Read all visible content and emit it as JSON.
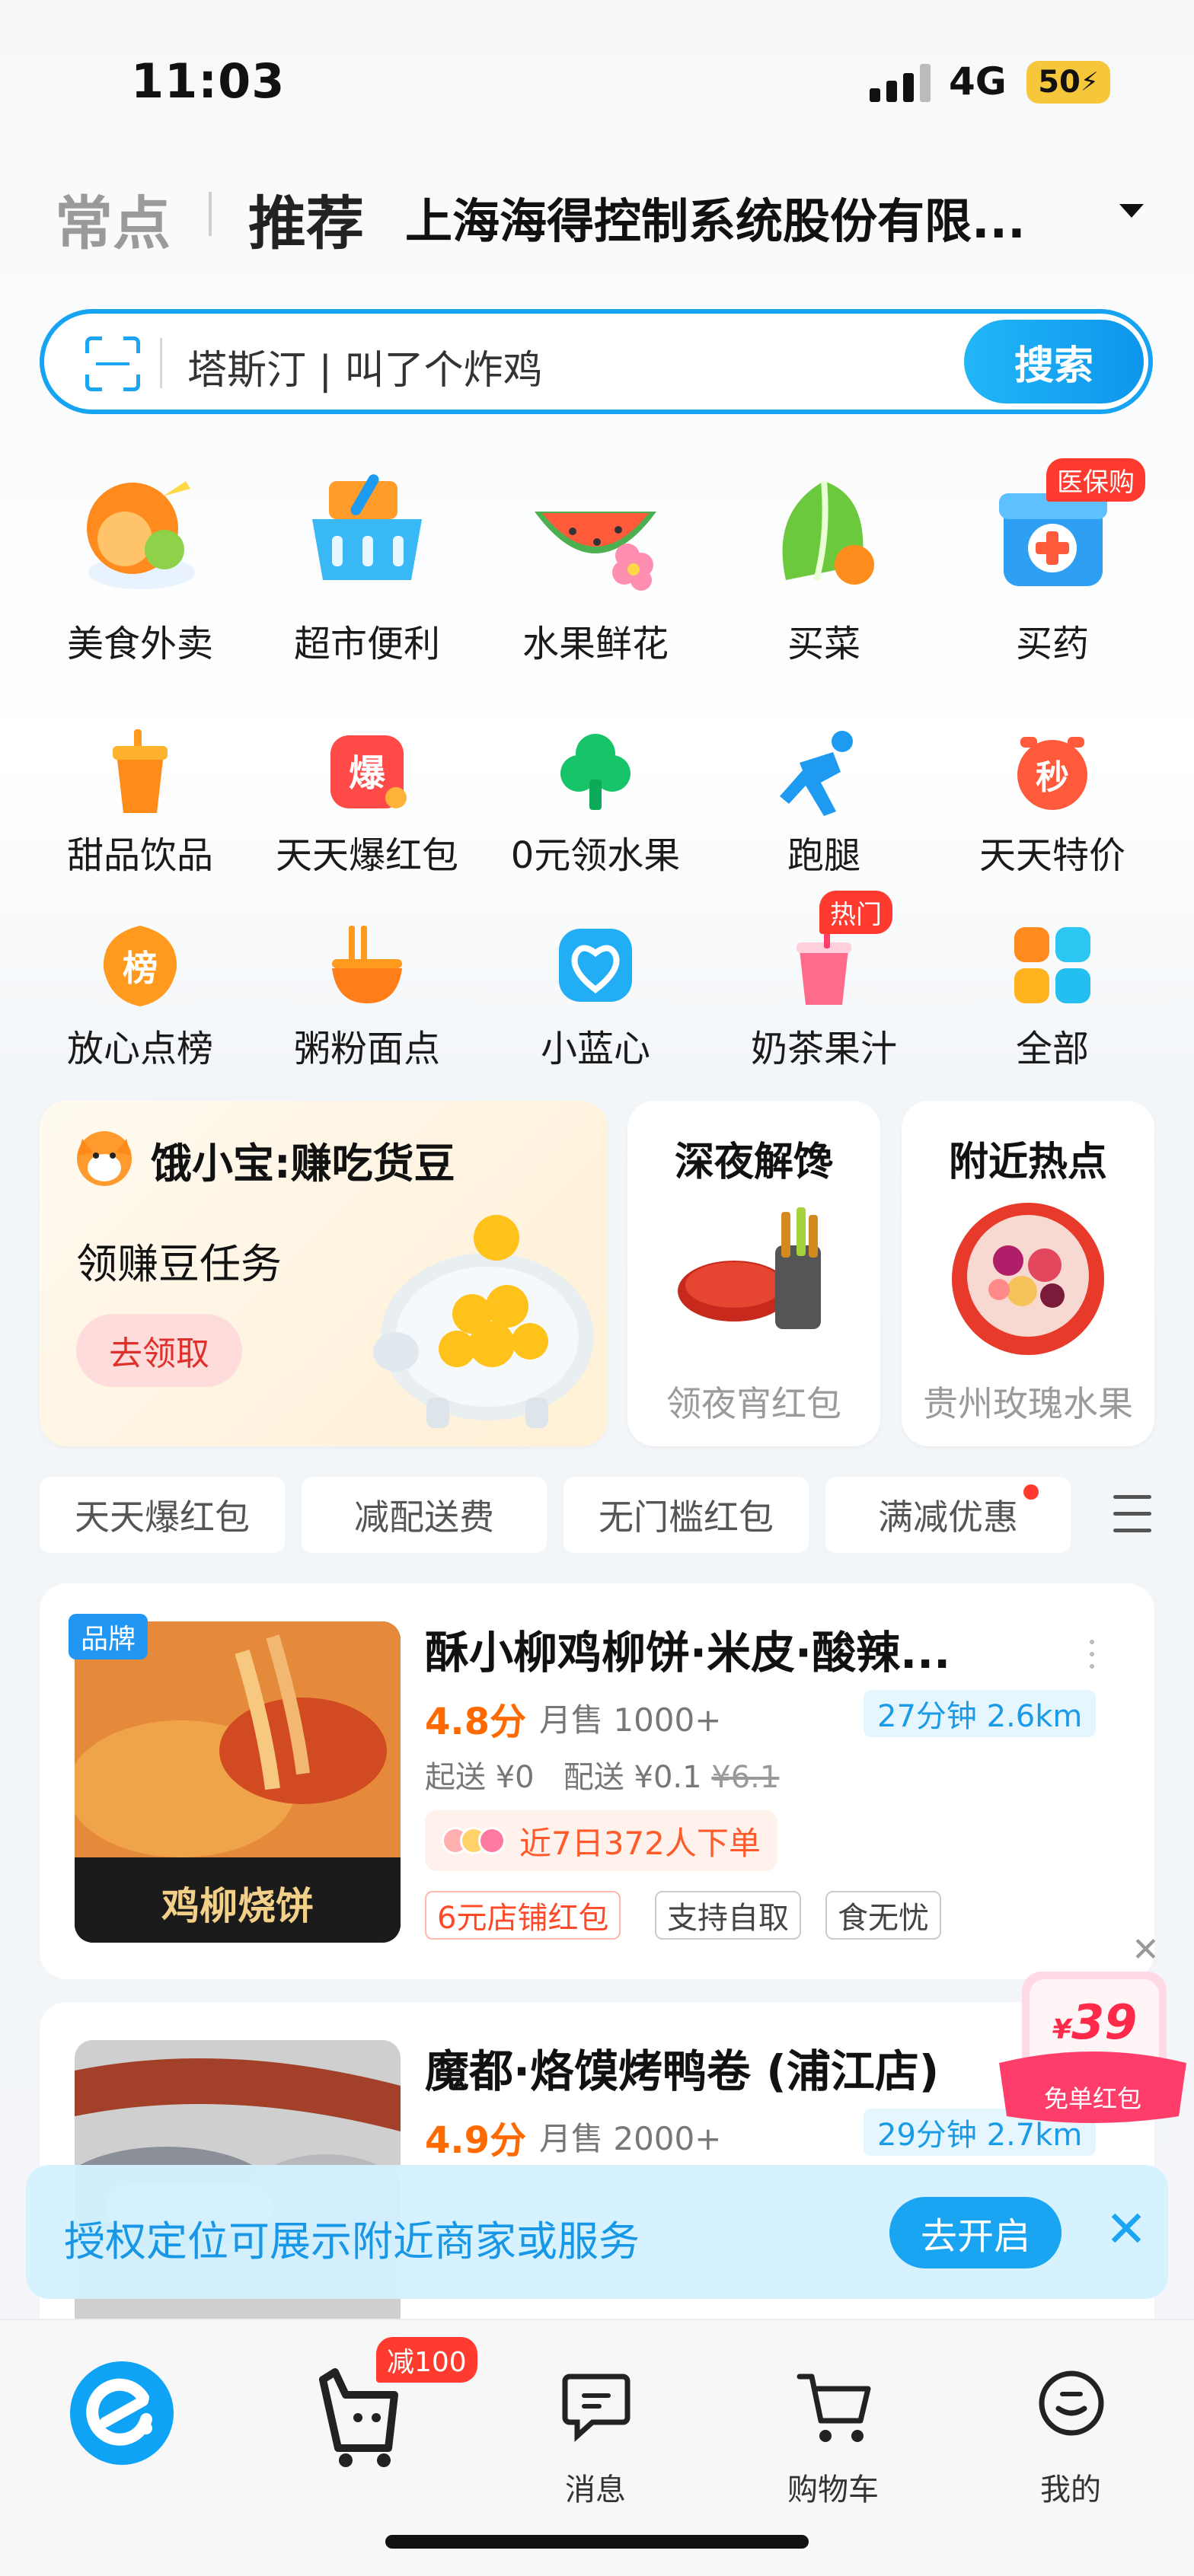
{
  "status_bar": {
    "time": "11:03",
    "network": "4G",
    "battery": "50"
  },
  "header": {
    "tabs": [
      "常点",
      "推荐"
    ],
    "location": "上海海得控制系统股份有限..."
  },
  "search": {
    "placeholder": "塔斯汀 | 叫了个炸鸡",
    "button": "搜索"
  },
  "categories": [
    {
      "label": "美食外卖",
      "icon": "food-delivery-icon"
    },
    {
      "label": "超市便利",
      "icon": "supermarket-basket-icon"
    },
    {
      "label": "水果鲜花",
      "icon": "fruit-flower-icon"
    },
    {
      "label": "买菜",
      "icon": "vegetable-icon"
    },
    {
      "label": "买药",
      "icon": "medicine-icon",
      "badge": "医保购"
    },
    {
      "label": "甜品饮品",
      "icon": "drink-cup-icon"
    },
    {
      "label": "天天爆红包",
      "icon": "red-packet-icon"
    },
    {
      "label": "0元领水果",
      "icon": "tree-icon"
    },
    {
      "label": "跑腿",
      "icon": "runner-icon"
    },
    {
      "label": "天天特价",
      "icon": "flash-sale-icon"
    },
    {
      "label": "放心点榜",
      "icon": "ranking-icon"
    },
    {
      "label": "粥粉面点",
      "icon": "noodle-bowl-icon"
    },
    {
      "label": "小蓝心",
      "icon": "blue-heart-icon"
    },
    {
      "label": "奶茶果汁",
      "icon": "milk-tea-icon",
      "badge": "热门"
    },
    {
      "label": "全部",
      "icon": "all-grid-icon"
    }
  ],
  "promo": {
    "main_title": "饿小宝:赚吃货豆",
    "main_subtitle": "领赚豆任务",
    "main_button": "去领取",
    "card2_title": "深夜解馋",
    "card2_subtitle": "领夜宵红包",
    "card3_title": "附近热点",
    "card3_subtitle": "贵州玫瑰水果"
  },
  "filters": [
    "天天爆红包",
    "减配送费",
    "无门槛红包",
    "满减优惠"
  ],
  "stores": [
    {
      "tag": "品牌",
      "name": "酥小柳鸡柳饼·米皮·酸辣...",
      "rating": "4.8分",
      "sales": "月售 1000+",
      "eta": "27分钟  2.6km",
      "min_order": "起送 ¥0",
      "delivery": "配送 ¥0.1",
      "delivery_original": "¥6.1",
      "orders": "近7日372人下单",
      "image_caption": "鸡柳烧饼",
      "tags": [
        "6元店铺红包",
        "支持自取",
        "食无忧"
      ]
    },
    {
      "name": "魔都·烙馍烤鸭卷 (浦江店)",
      "rating": "4.9分",
      "sales": "月售 2000+",
      "eta": "29分钟  2.7km"
    }
  ],
  "floating_packet": {
    "amount": "39",
    "label": "免单红包"
  },
  "location_banner": {
    "text": "授权定位可展示附近商家或服务",
    "button": "去开启"
  },
  "tabbar": {
    "cart_badge": "减100",
    "items": [
      "消息",
      "购物车",
      "我的"
    ]
  },
  "colors": {
    "accent": "#16a3f2",
    "price": "#ff6a00",
    "red": "#ff3b2f"
  }
}
